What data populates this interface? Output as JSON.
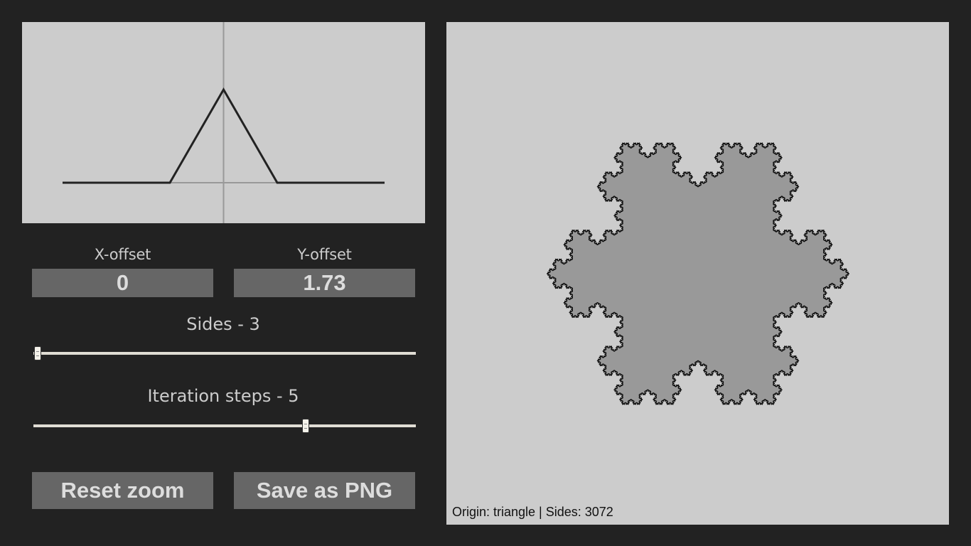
{
  "controls": {
    "x_offset_label": "X-offset",
    "x_offset_value": "0",
    "y_offset_label": "Y-offset",
    "y_offset_value": "1.73",
    "sides_label": "Sides - 3",
    "sides_value": 3,
    "iterations_label": "Iteration steps - 5",
    "iterations_value": 5,
    "reset_zoom_label": "Reset zoom",
    "save_png_label": "Save as PNG"
  },
  "canvas": {
    "status_text": "Origin: triangle | Sides: 3072",
    "origin": "triangle",
    "total_sides": 3072
  },
  "colors": {
    "background": "#222222",
    "panel": "#cccccc",
    "control": "#666666",
    "fractal_fill": "#999999",
    "fractal_stroke": "#111111"
  }
}
